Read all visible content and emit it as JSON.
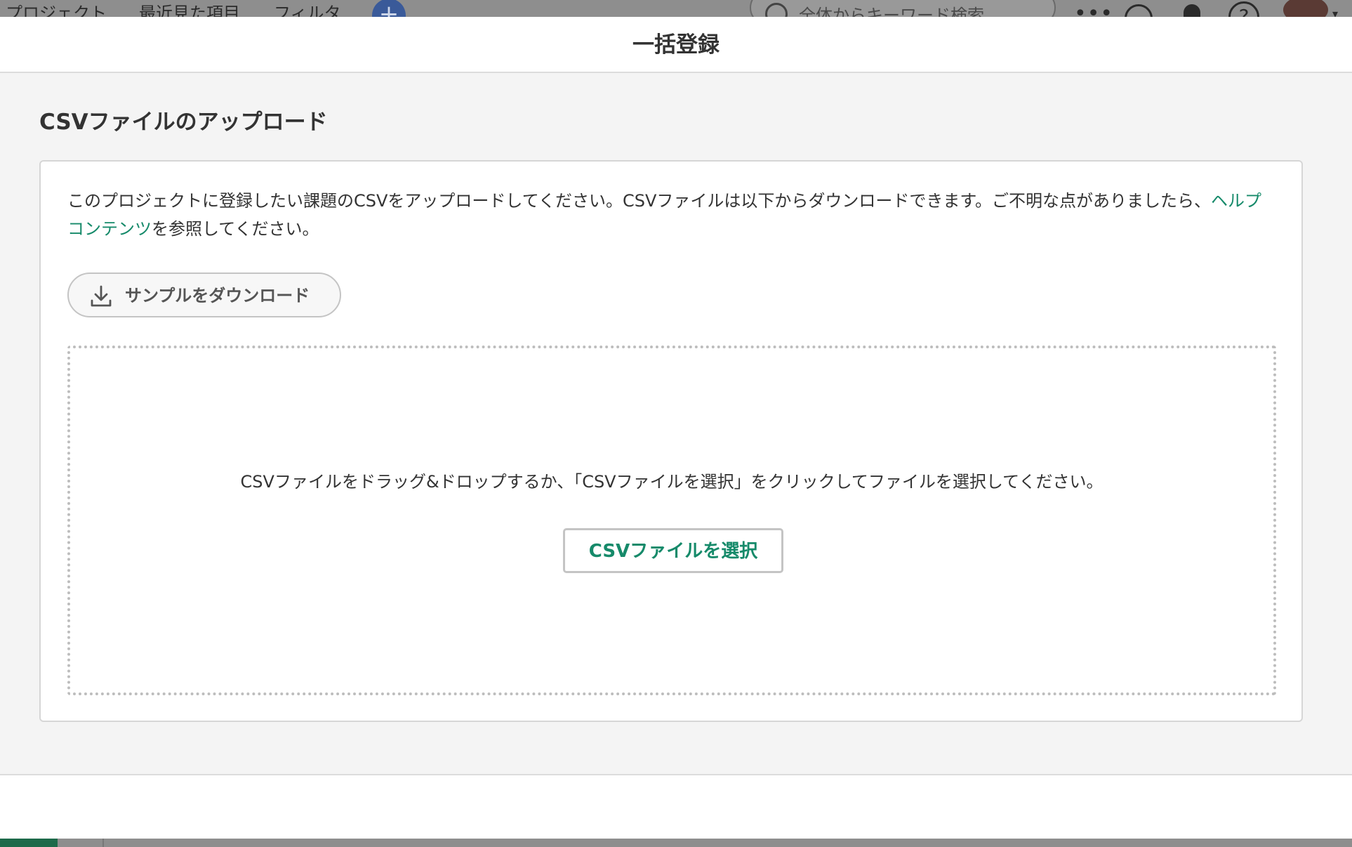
{
  "background_app": {
    "nav_items": [
      "プロジェクト",
      "最近見た項目",
      "フィルタ"
    ],
    "search_placeholder": "全体からキーワード検索",
    "icons": [
      "add-icon",
      "search-icon",
      "more-icon",
      "globe-icon",
      "bell-icon",
      "help-icon",
      "avatar",
      "chevron-down-icon"
    ]
  },
  "modal": {
    "title": "一括登録",
    "section_title": "CSVファイルのアップロード",
    "description_before_link": "このプロジェクトに登録したい課題のCSVをアップロードしてください。CSVファイルは以下からダウンロードできます。ご不明な点がありましたら、",
    "help_link": "ヘルプコンテンツ",
    "description_after_link": "を参照してください。",
    "download_sample_label": "サンプルをダウンロード",
    "dropzone_text": "CSVファイルをドラッグ&ドロップするか、「CSVファイルを選択」をクリックしてファイルを選択してください。",
    "select_file_label": "CSVファイルを選択"
  },
  "colors": {
    "accent": "#168a6a",
    "body_bg": "#f4f4f4",
    "border": "#d6d6d6"
  }
}
